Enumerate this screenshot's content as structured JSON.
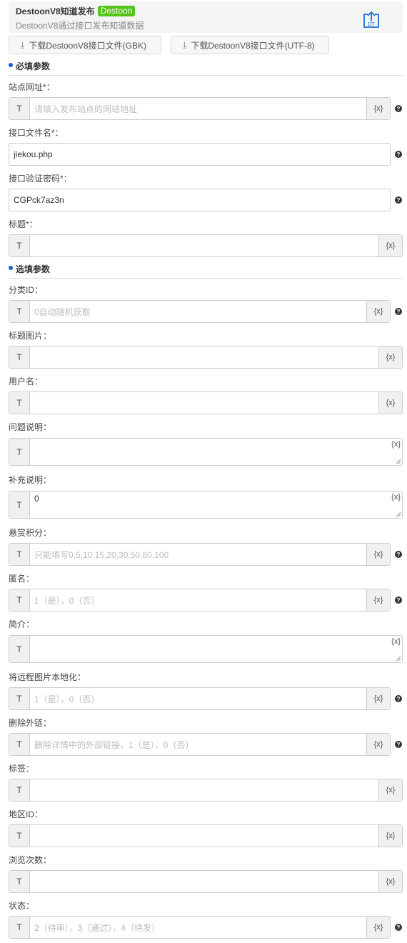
{
  "header": {
    "title": "DestoonV8知道发布",
    "badge": "Destoon",
    "subtitle": "DestoonV8通过接口发布知道数据",
    "icon_label": "DT"
  },
  "downloads": {
    "gbk": "下载DestoonV8接口文件(GBK)",
    "utf8": "下载DestoonV8接口文件(UTF-8)"
  },
  "sections": {
    "required": "必填参数",
    "optional": "选填参数"
  },
  "prefix": "T",
  "var_button": "{x}",
  "help_glyph": "?",
  "fields": {
    "site_url": {
      "label": "站点网址*：",
      "placeholder": "请填入发布站点的网站地址"
    },
    "api_file": {
      "label": "接口文件名*：",
      "value": "jiekou.php"
    },
    "api_password": {
      "label": "接口验证密码*：",
      "value": "CGPck7az3n"
    },
    "title": {
      "label": "标题*："
    },
    "category_id": {
      "label": "分类ID：",
      "placeholder": "0自动随机获取"
    },
    "title_image": {
      "label": "标题图片："
    },
    "username": {
      "label": "用户名："
    },
    "question_desc": {
      "label": "问题说明："
    },
    "supplement": {
      "label": "补充说明：",
      "value": "0"
    },
    "reward_points": {
      "label": "悬赏积分：",
      "placeholder": "只能填写0,5,10,15,20,30,50,80,100"
    },
    "anonymous": {
      "label": "匿名：",
      "placeholder": "1（是），0（否）"
    },
    "intro": {
      "label": "简介："
    },
    "localize_images": {
      "label": "将远程图片本地化：",
      "placeholder": "1（是），0（否）"
    },
    "remove_links": {
      "label": "删除外链：",
      "placeholder": "删除详情中的外部链接，1（是），0（否）"
    },
    "tags": {
      "label": "标签："
    },
    "area_id": {
      "label": "地区ID："
    },
    "views": {
      "label": "浏览次数："
    },
    "status": {
      "label": "状态：",
      "placeholder": "2（待审），3（通过），4（待发）"
    }
  }
}
